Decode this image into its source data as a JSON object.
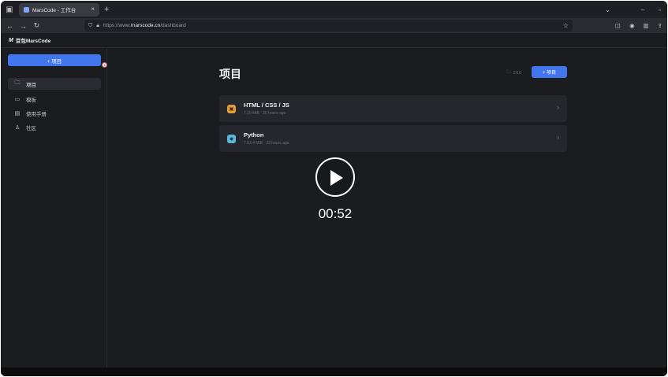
{
  "browser": {
    "tab_title": "MarsCode - 工作台",
    "new_tab": "+",
    "close": "×",
    "url_prefix": "https://www.",
    "url_domain": "marscode.cn",
    "url_path": "/dashboard"
  },
  "app": {
    "logo_mark": "M",
    "logo_text": "豆包MarsCode",
    "new_project_label": "+ 项目",
    "sidebar": [
      {
        "label": "项目",
        "icon": "folder-icon",
        "glyph": "🗀",
        "active": true
      },
      {
        "label": "模板",
        "icon": "monitor-icon",
        "glyph": "▭",
        "active": false
      },
      {
        "label": "使用手册",
        "icon": "book-icon",
        "glyph": "▤",
        "active": false
      },
      {
        "label": "社区",
        "icon": "community-icon",
        "glyph": "♙",
        "active": false
      }
    ]
  },
  "main": {
    "title": "项目",
    "count": "2/10",
    "create_label": "+ 项目",
    "projects": [
      {
        "name": "HTML / CSS / JS",
        "meta": "7.19 MiB · 20 hours ago",
        "icon": "html-icon",
        "color": "#e39a37"
      },
      {
        "name": "Python",
        "meta": "7.03.4 MiB · 22 hours ago",
        "icon": "python-icon",
        "color": "#57b8dc"
      }
    ]
  },
  "video": {
    "time": "00:52"
  },
  "colors": {
    "accent": "#4276ef",
    "background": "#1b1c20",
    "card": "#26272c"
  }
}
